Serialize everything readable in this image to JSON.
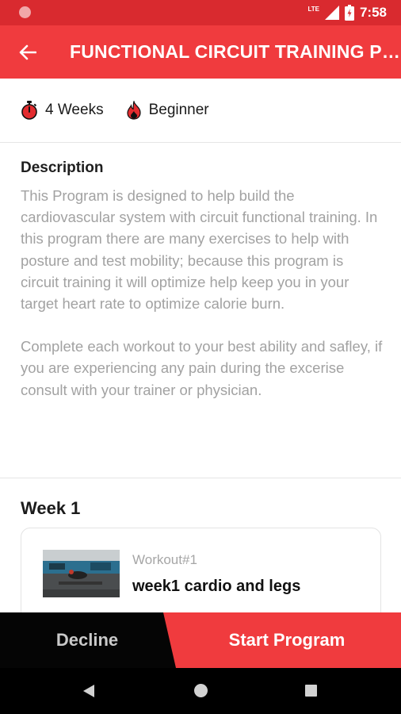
{
  "status_bar": {
    "network_label": "LTE",
    "time": "7:58"
  },
  "header": {
    "title": "FUNCTIONAL CIRCUIT TRAINING PROGR...",
    "back_icon": "arrow-left-icon"
  },
  "program_meta": {
    "duration": "4 Weeks",
    "duration_icon": "stopwatch-icon",
    "level": "Beginner",
    "level_icon": "flame-icon"
  },
  "description": {
    "title": "Description",
    "paragraphs": [
      "This Program is designed to help build the cardiovascular system with circuit functional training. In this program there are many exercises to help with posture and test mobility; because this program is circuit training it will optimize help keep you in your target heart rate to optimize calorie burn.",
      "Complete each workout to your best ability and safley, if you are experiencing any pain during the excerise consult with your trainer or physician."
    ]
  },
  "weeks": [
    {
      "title": "Week 1",
      "workouts": [
        {
          "number_label": "Workout#1",
          "name": "week1 cardio and legs"
        }
      ]
    }
  ],
  "actions": {
    "decline_label": "Decline",
    "start_label": "Start Program"
  },
  "colors": {
    "primary": "#f03b3e",
    "status_bar": "#d92a2f",
    "muted_text": "#a2a2a2",
    "bottom_dark": "#050505"
  }
}
